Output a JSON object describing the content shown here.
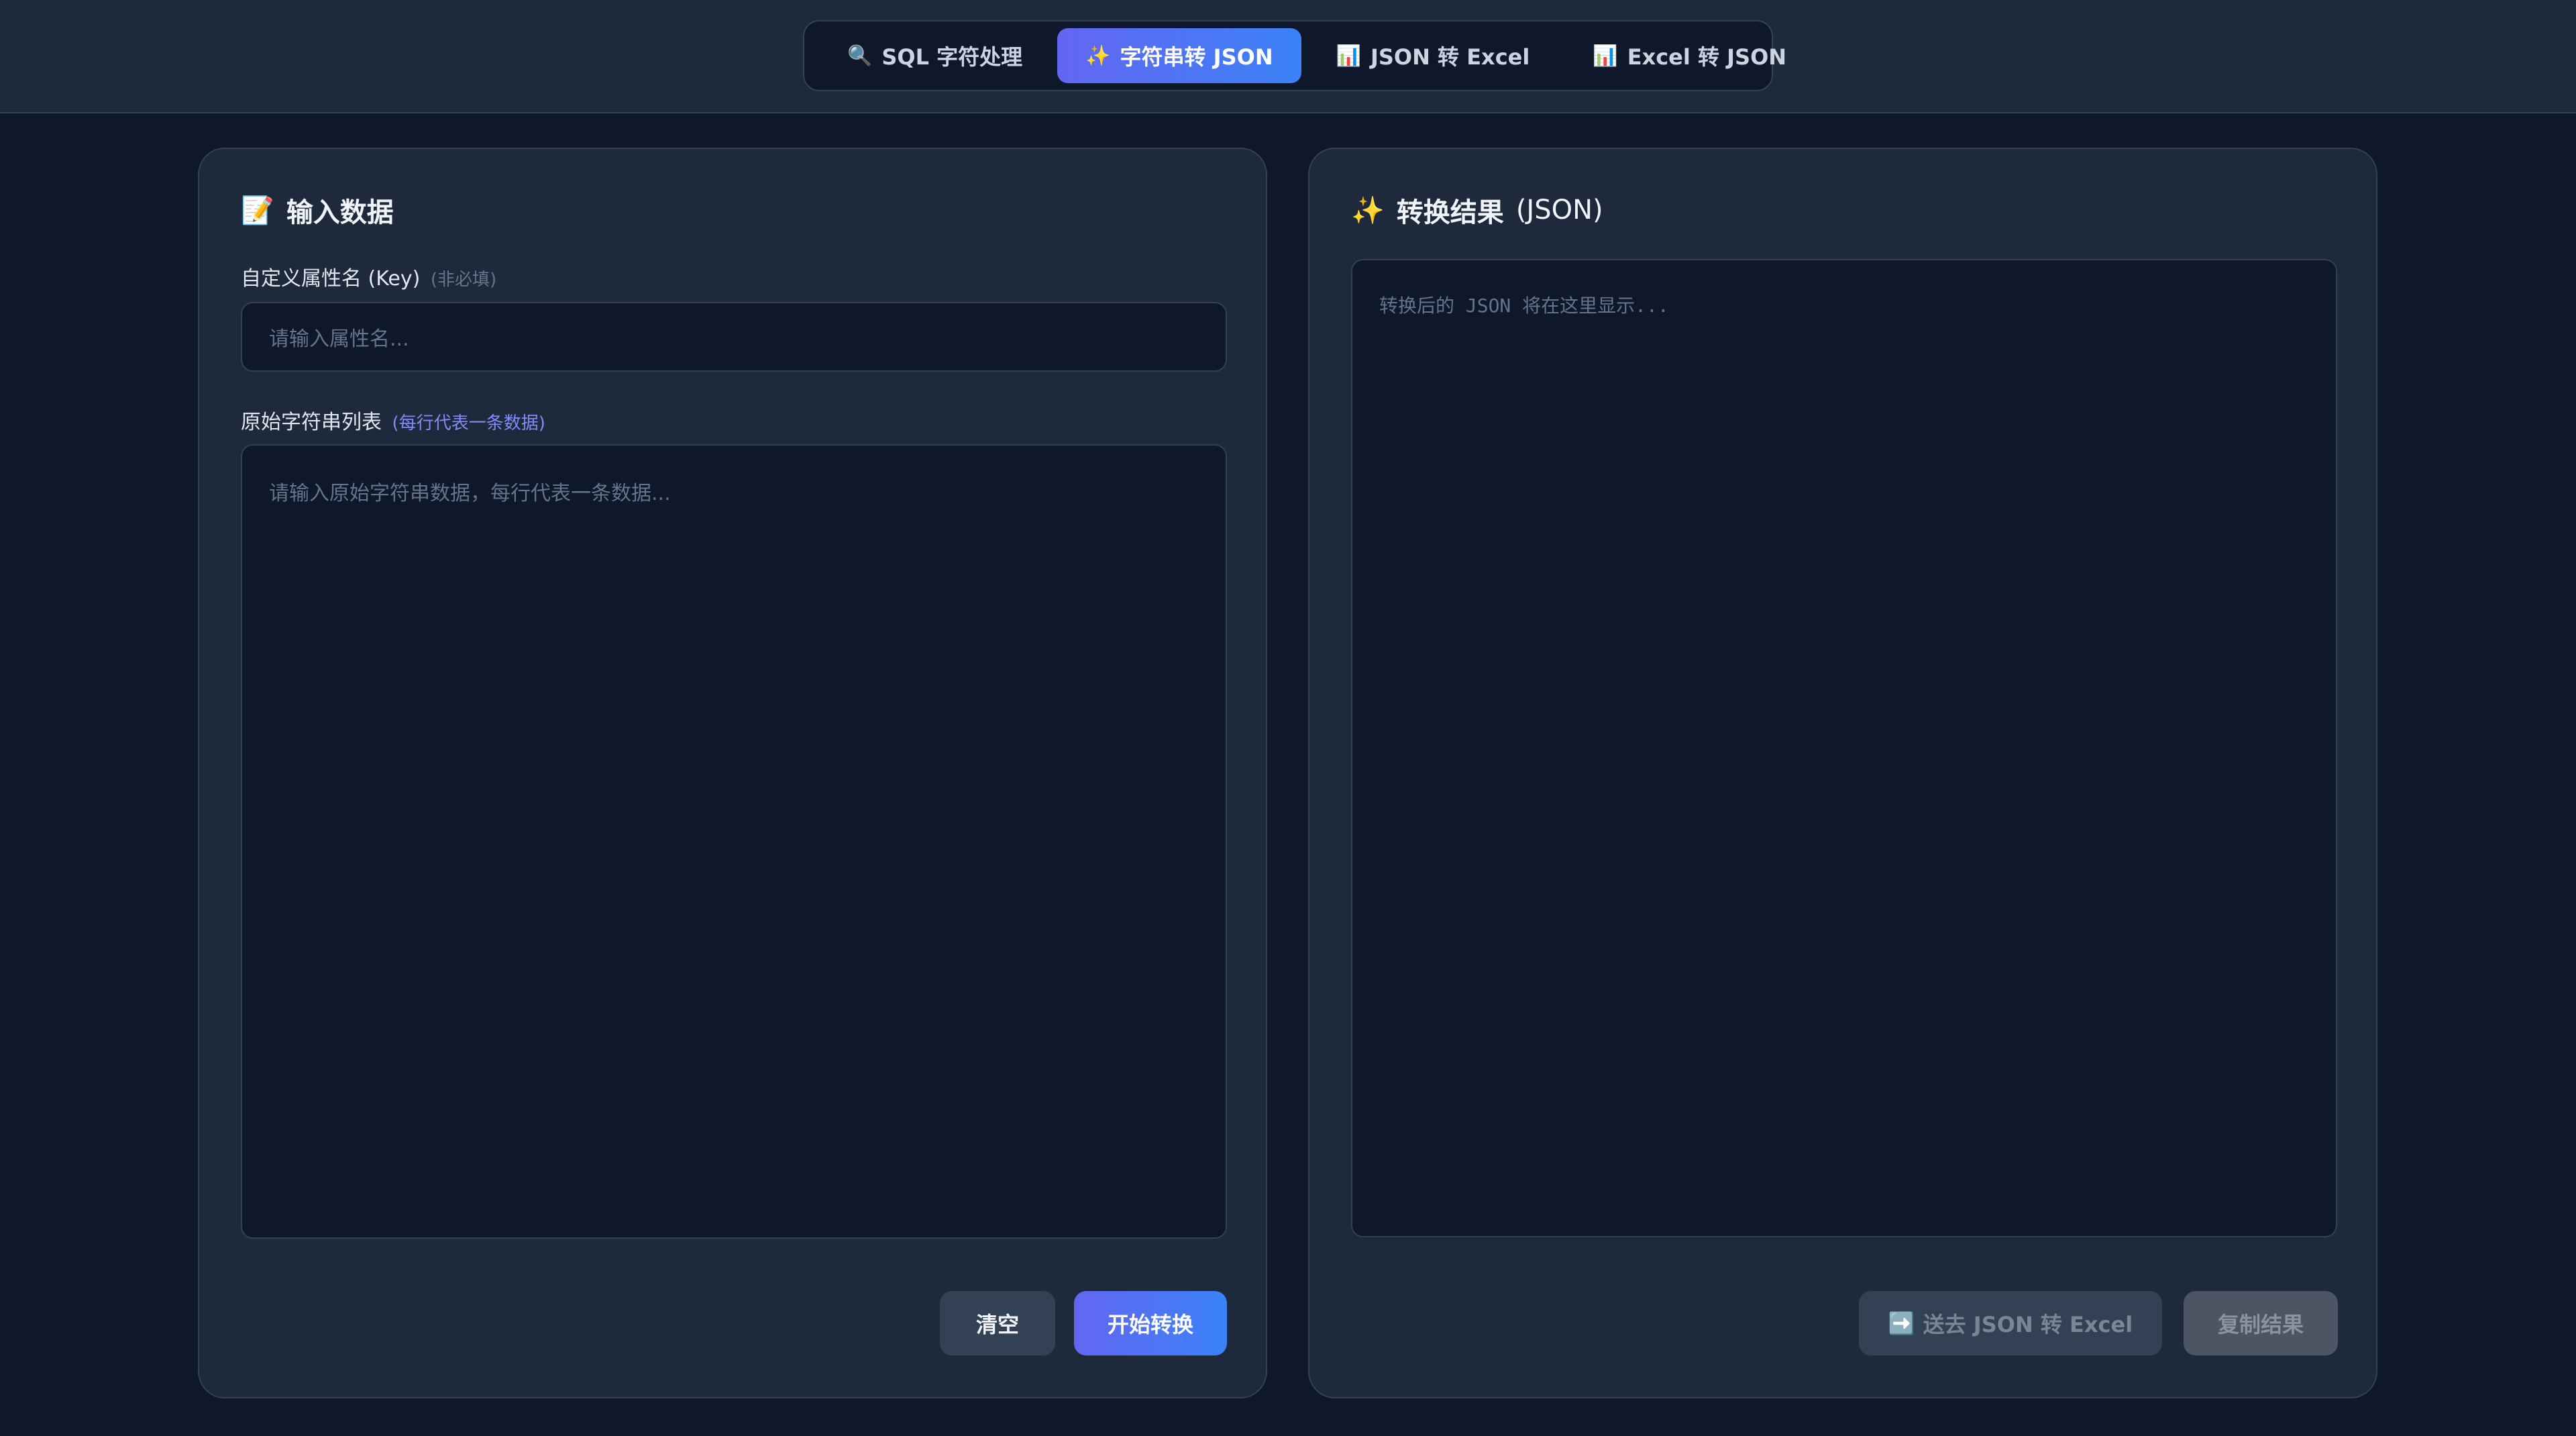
{
  "tabs": [
    {
      "icon": "🔍",
      "label": "SQL 字符处理"
    },
    {
      "icon": "✨",
      "label": "字符串转 JSON"
    },
    {
      "icon": "📊",
      "label": "JSON 转 Excel"
    },
    {
      "icon": "📊",
      "label": "Excel 转 JSON"
    }
  ],
  "active_tab": 1,
  "input_panel": {
    "icon": "📝",
    "title": "输入数据",
    "key_label": "自定义属性名 (Key)",
    "key_hint": "(非必填)",
    "key_placeholder": "请输入属性名...",
    "list_label": "原始字符串列表",
    "list_hint": "(每行代表一条数据)",
    "list_placeholder": "请输入原始字符串数据，每行代表一条数据...",
    "clear_label": "清空",
    "convert_label": "开始转换"
  },
  "output_panel": {
    "icon": "✨",
    "title": "转换结果",
    "title_suffix": "(JSON)",
    "placeholder": "转换后的 JSON 将在这里显示...",
    "send_icon": "➡️",
    "send_label": "送去 JSON 转 Excel",
    "copy_label": "复制结果"
  },
  "colors": {
    "background": "#0f172a",
    "panel": "#1e293b",
    "accent_start": "#6366f1",
    "accent_end": "#3b82f6",
    "hint_accent": "#818cf8"
  }
}
